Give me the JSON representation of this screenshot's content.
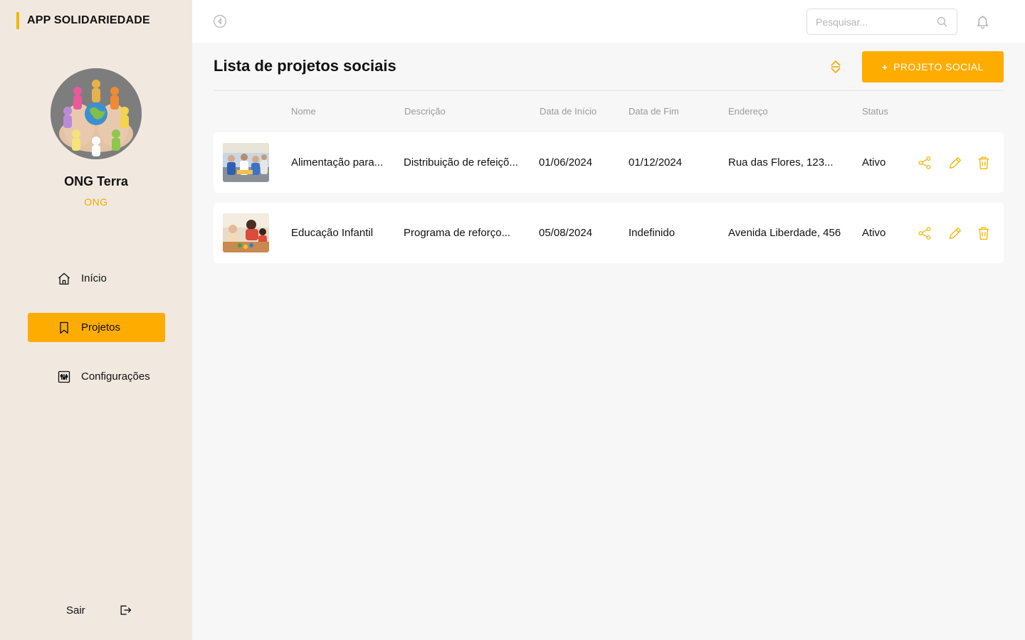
{
  "brand": {
    "title": "APP SOLIDARIEDADE"
  },
  "profile": {
    "name": "ONG Terra",
    "type": "ONG"
  },
  "nav": {
    "items": [
      {
        "label": "Início",
        "icon": "home-icon",
        "active": false
      },
      {
        "label": "Projetos",
        "icon": "bookmark-icon",
        "active": true
      },
      {
        "label": "Configurações",
        "icon": "settings-icon",
        "active": false
      }
    ],
    "logout_label": "Sair"
  },
  "topbar": {
    "search_placeholder": "Pesquisar...",
    "icons": [
      "collapse-icon",
      "search-icon",
      "bell-icon"
    ]
  },
  "page": {
    "title": "Lista de projetos sociais",
    "add_button_label": "PROJETO SOCIAL",
    "add_button_icon": "+"
  },
  "table": {
    "columns": [
      "Nome",
      "Descrição",
      "Data de Início",
      "Data de Fim",
      "Endereço",
      "Status"
    ],
    "rows": [
      {
        "name": "Alimentação para...",
        "description": "Distribuição de refeiçõ...",
        "start": "01/06/2024",
        "end": "01/12/2024",
        "address": "Rua das Flores, 123...",
        "status": "Ativo"
      },
      {
        "name": "Educação Infantil",
        "description": "Programa de reforço...",
        "start": "05/08/2024",
        "end": "Indefinido",
        "address": "Avenida Liberdade, 456",
        "status": "Ativo"
      }
    ],
    "row_actions": [
      "share-icon",
      "edit-icon",
      "trash-icon"
    ]
  },
  "colors": {
    "accent": "#ffac00",
    "sidebar_bg": "#f1e8df",
    "page_bg": "#f7f7f7",
    "icon_accent": "#f2b705"
  }
}
